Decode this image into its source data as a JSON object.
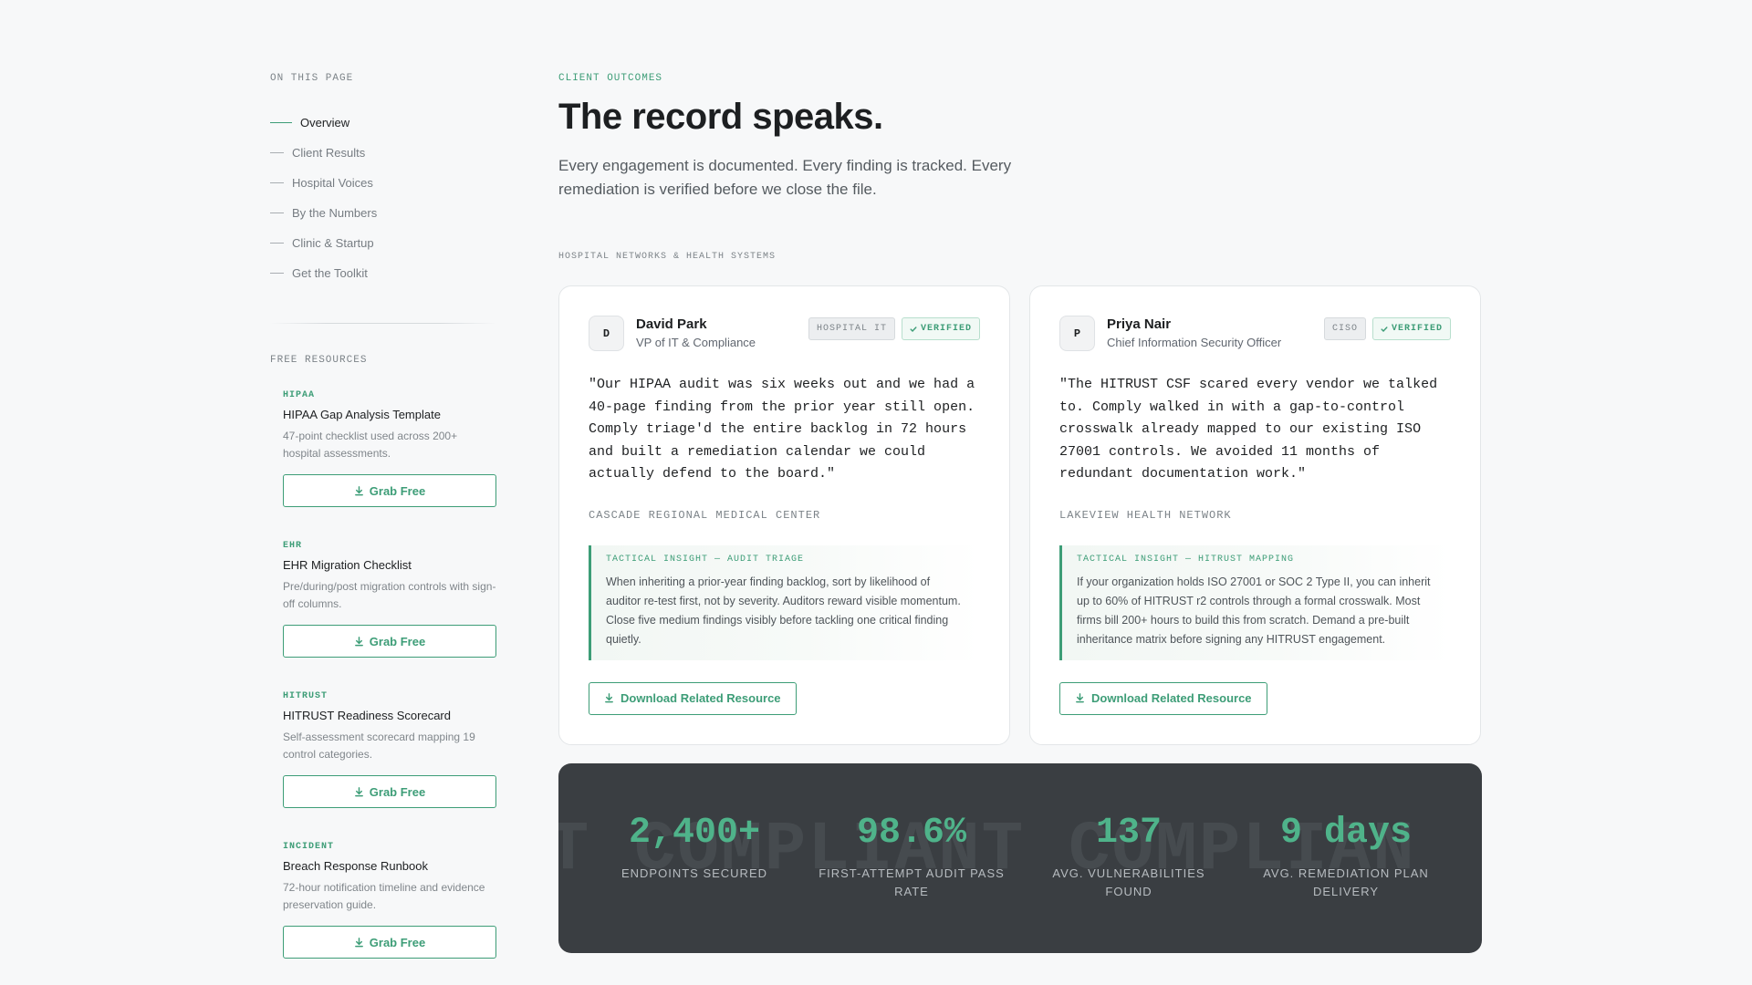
{
  "sidebar": {
    "on_this_page": "ON THIS PAGE",
    "toc": [
      {
        "label": "Overview",
        "active": true
      },
      {
        "label": "Client Results",
        "active": false
      },
      {
        "label": "Hospital Voices",
        "active": false
      },
      {
        "label": "By the Numbers",
        "active": false
      },
      {
        "label": "Clinic & Startup",
        "active": false
      },
      {
        "label": "Get the Toolkit",
        "active": false
      }
    ],
    "free_resources": "FREE RESOURCES",
    "resources": [
      {
        "tag": "HIPAA",
        "title": "HIPAA Gap Analysis Template",
        "desc": "47-point checklist used across 200+ hospital assessments.",
        "button": "Grab Free"
      },
      {
        "tag": "EHR",
        "title": "EHR Migration Checklist",
        "desc": "Pre/during/post migration controls with sign-off columns.",
        "button": "Grab Free"
      },
      {
        "tag": "HITRUST",
        "title": "HITRUST Readiness Scorecard",
        "desc": "Self-assessment scorecard mapping 19 control categories.",
        "button": "Grab Free"
      },
      {
        "tag": "INCIDENT",
        "title": "Breach Response Runbook",
        "desc": "72-hour notification timeline and evidence preservation guide.",
        "button": "Grab Free"
      }
    ]
  },
  "main": {
    "eyebrow": "CLIENT OUTCOMES",
    "headline": "The record speaks.",
    "lede": "Every engagement is documented. Every finding is tracked. Every remediation is verified before we close the file.",
    "section_eyebrow": "HOSPITAL NETWORKS & HEALTH SYSTEMS",
    "cards": [
      {
        "initial": "D",
        "name": "David Park",
        "role": "VP of IT & Compliance",
        "category": "HOSPITAL IT",
        "verified": "VERIFIED",
        "quote": "\"Our HIPAA audit was six weeks out and we had a 40-page finding from the prior year still open. Comply triage'd the entire backlog in 72 hours and built a remediation calendar we could actually defend to the board.\"",
        "org": "CASCADE REGIONAL MEDICAL CENTER",
        "insight_label": "TACTICAL INSIGHT — AUDIT TRIAGE",
        "insight_text": "When inheriting a prior-year finding backlog, sort by likelihood of auditor re-test first, not by severity. Auditors reward visible momentum. Close five medium findings visibly before tackling one critical finding quietly.",
        "button": "Download Related Resource"
      },
      {
        "initial": "P",
        "name": "Priya Nair",
        "role": "Chief Information Security Officer",
        "category": "CISO",
        "verified": "VERIFIED",
        "quote": "\"The HITRUST CSF scared every vendor we talked to. Comply walked in with a gap-to-control crosswalk already mapped to our existing ISO 27001 controls. We avoided 11 months of redundant documentation work.\"",
        "org": "LAKEVIEW HEALTH NETWORK",
        "insight_label": "TACTICAL INSIGHT — HITRUST MAPPING",
        "insight_text": "If your organization holds ISO 27001 or SOC 2 Type II, you can inherit up to 60% of HITRUST r2 controls through a formal crosswalk. Most firms bill 200+ hours to build this from scratch. Demand a pre-built inheritance matrix before signing any HITRUST engagement.",
        "button": "Download Related Resource"
      }
    ],
    "stats": {
      "watermark": "NT COMPLIANT COMPLIAN",
      "items": [
        {
          "value": "2,400+",
          "label": "ENDPOINTS SECURED"
        },
        {
          "value": "98.6%",
          "label": "FIRST-ATTEMPT AUDIT PASS RATE"
        },
        {
          "value": "137",
          "label": "AVG. VULNERABILITIES FOUND"
        },
        {
          "value": "9 days",
          "label": "AVG. REMEDIATION PLAN DELIVERY"
        }
      ]
    }
  },
  "colors": {
    "accent": "#3d9d77",
    "stat_value": "#4fb38a",
    "stats_bg": "#3a3e42",
    "page_bg": "#f7f8f9"
  }
}
